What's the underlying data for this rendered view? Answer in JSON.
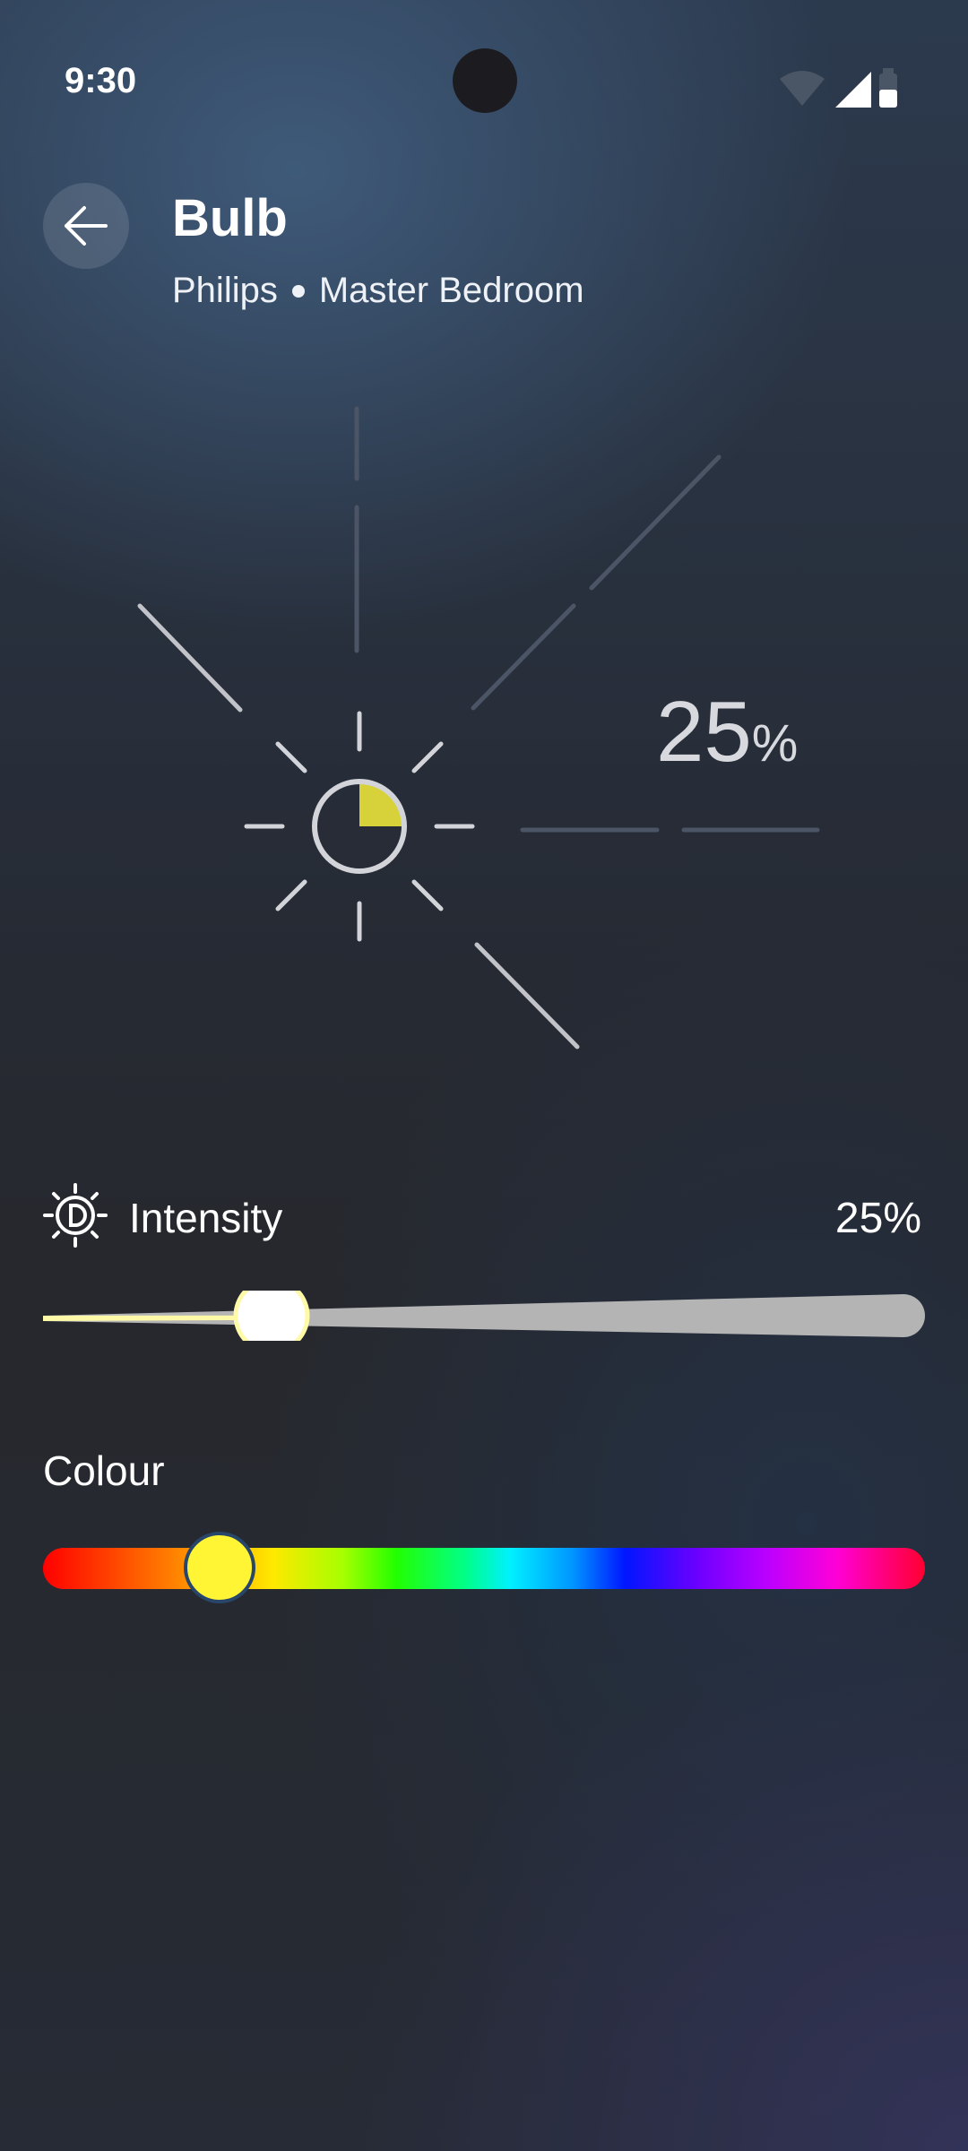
{
  "status_bar": {
    "time": "9:30"
  },
  "header": {
    "title": "Bulb",
    "brand": "Philips",
    "room": "Master Bedroom"
  },
  "hero": {
    "value": "25",
    "unit": "%"
  },
  "intensity": {
    "label": "Intensity",
    "value_text": "25%",
    "level": 0.25
  },
  "colour": {
    "label": "Colour",
    "selected_color": "#fff534"
  },
  "colors": {
    "accent_yellow": "#d7d23a",
    "track_fill": "#fffaa8",
    "track_empty": "#b4b4b4"
  }
}
